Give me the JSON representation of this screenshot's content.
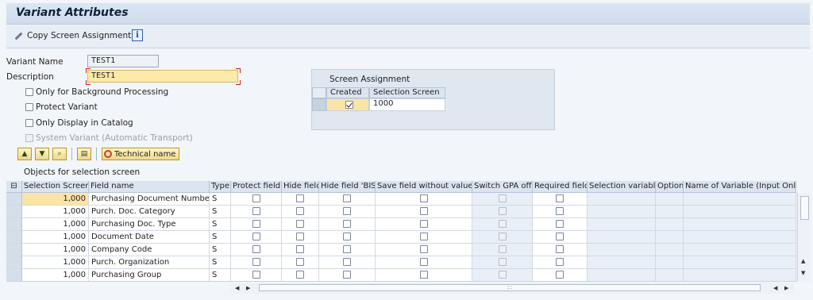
{
  "title": "Variant Attributes",
  "toolbar": {
    "copy_label": "Copy Screen Assignment",
    "info_icon": "i"
  },
  "form": {
    "variant_name_label": "Variant Name",
    "variant_name_value": "TEST1",
    "description_label": "Description",
    "description_value": "TEST1",
    "checkboxes": [
      {
        "label": "Only for Background Processing",
        "checked": false,
        "disabled": false
      },
      {
        "label": "Protect Variant",
        "checked": false,
        "disabled": false
      },
      {
        "label": "Only Display in Catalog",
        "checked": false,
        "disabled": false
      },
      {
        "label": "System Variant (Automatic Transport)",
        "checked": false,
        "disabled": true
      }
    ]
  },
  "screen_assignment": {
    "title": "Screen Assignment",
    "col_created": "Created",
    "col_screen": "Selection Screen",
    "rows": [
      {
        "created": true,
        "screen": "1000"
      }
    ]
  },
  "table_toolbar": {
    "tech_name_label": "Technical name"
  },
  "grid": {
    "caption": "Objects for selection screen",
    "headers": [
      "Selection Screen",
      "Field name",
      "Type",
      "Protect field",
      "Hide field",
      "Hide field 'BIS'",
      "Save field without values",
      "Switch GPA off",
      "Required field",
      "Selection variable",
      "Option",
      "Name of Variable (Input Only"
    ],
    "rows": [
      {
        "screen": "1,000",
        "field": "Purchasing Document Number",
        "type": "S"
      },
      {
        "screen": "1,000",
        "field": "Purch. Doc. Category",
        "type": "S"
      },
      {
        "screen": "1,000",
        "field": "Purchasing Doc. Type",
        "type": "S"
      },
      {
        "screen": "1,000",
        "field": "Document Date",
        "type": "S"
      },
      {
        "screen": "1,000",
        "field": "Company Code",
        "type": "S"
      },
      {
        "screen": "1,000",
        "field": "Purch. Organization",
        "type": "S"
      },
      {
        "screen": "1,000",
        "field": "Purchasing Group",
        "type": "S"
      }
    ]
  },
  "colors": {
    "required_field": "#fbe9a8",
    "header_bg": "#dbe5f1",
    "selected_cell": "#fbe4a6"
  }
}
